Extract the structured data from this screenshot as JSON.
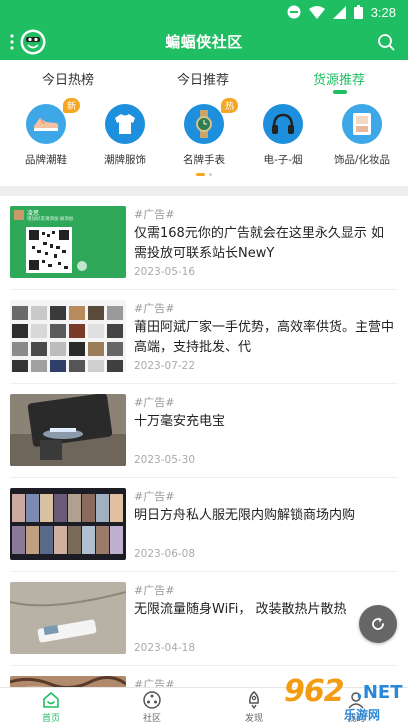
{
  "status_bar": {
    "time": "3:28"
  },
  "header": {
    "title": "蝙蝠侠社区"
  },
  "tabs": [
    {
      "label": "今日热榜"
    },
    {
      "label": "今日推荐"
    },
    {
      "label": "货源推荐",
      "active": true
    }
  ],
  "categories": [
    {
      "label": "品牌潮鞋",
      "badge": "新",
      "icon": "sneaker-icon",
      "color": "#3da7e8"
    },
    {
      "label": "潮牌服饰",
      "badge": "",
      "icon": "tshirt-icon",
      "color": "#1e8fdc"
    },
    {
      "label": "名牌手表",
      "badge": "热",
      "icon": "watch-icon",
      "color": "#1e8fdc"
    },
    {
      "label": "电-子-烟",
      "badge": "",
      "icon": "headphones-icon",
      "color": "#1e8fdc"
    },
    {
      "label": "饰品/化妆品",
      "badge": "",
      "icon": "cosmetics-icon",
      "color": "#3da7e8"
    }
  ],
  "list": [
    {
      "tag": "#广告#",
      "text": "仅需168元你的广告就会在这里永久显示 如需投放可联系站长NewY",
      "date": "2023-05-16",
      "thumb": "qr-code",
      "thumb_name": "凌思",
      "thumb_caption": "增加好友请添加 被添加"
    },
    {
      "tag": "#广告#",
      "text": "莆田阿斌厂家一手优势，高效率供货。主营中高端，支持批发、代",
      "date": "2023-07-22",
      "thumb": "shoe-grid"
    },
    {
      "tag": "#广告#",
      "text": "十万毫安充电宝",
      "date": "2023-05-30",
      "thumb": "power-bank"
    },
    {
      "tag": "#广告#",
      "text": "明日方舟私人服无限内购解锁商场内购",
      "date": "2023-06-08",
      "thumb": "game-cards"
    },
    {
      "tag": "#广告#",
      "text": "无限流量随身WiFi， 改装散热片散热",
      "date": "2023-04-18",
      "thumb": "usb-wifi"
    },
    {
      "tag": "#广告#",
      "text": "",
      "date": "",
      "thumb": "carpet"
    }
  ],
  "bottom_nav": [
    {
      "label": "首页",
      "active": true,
      "icon": "home-icon"
    },
    {
      "label": "社区",
      "active": false,
      "icon": "community-icon"
    },
    {
      "label": "发现",
      "active": false,
      "icon": "rocket-icon"
    },
    {
      "label": "我的",
      "active": false,
      "icon": "user-icon"
    }
  ],
  "watermark": {
    "number": "962",
    "net": ".NET",
    "sub": "乐游网"
  },
  "colors": {
    "brand": "#1fbe63",
    "accent": "#f5a623",
    "icon_blue": "#1e8fdc"
  }
}
